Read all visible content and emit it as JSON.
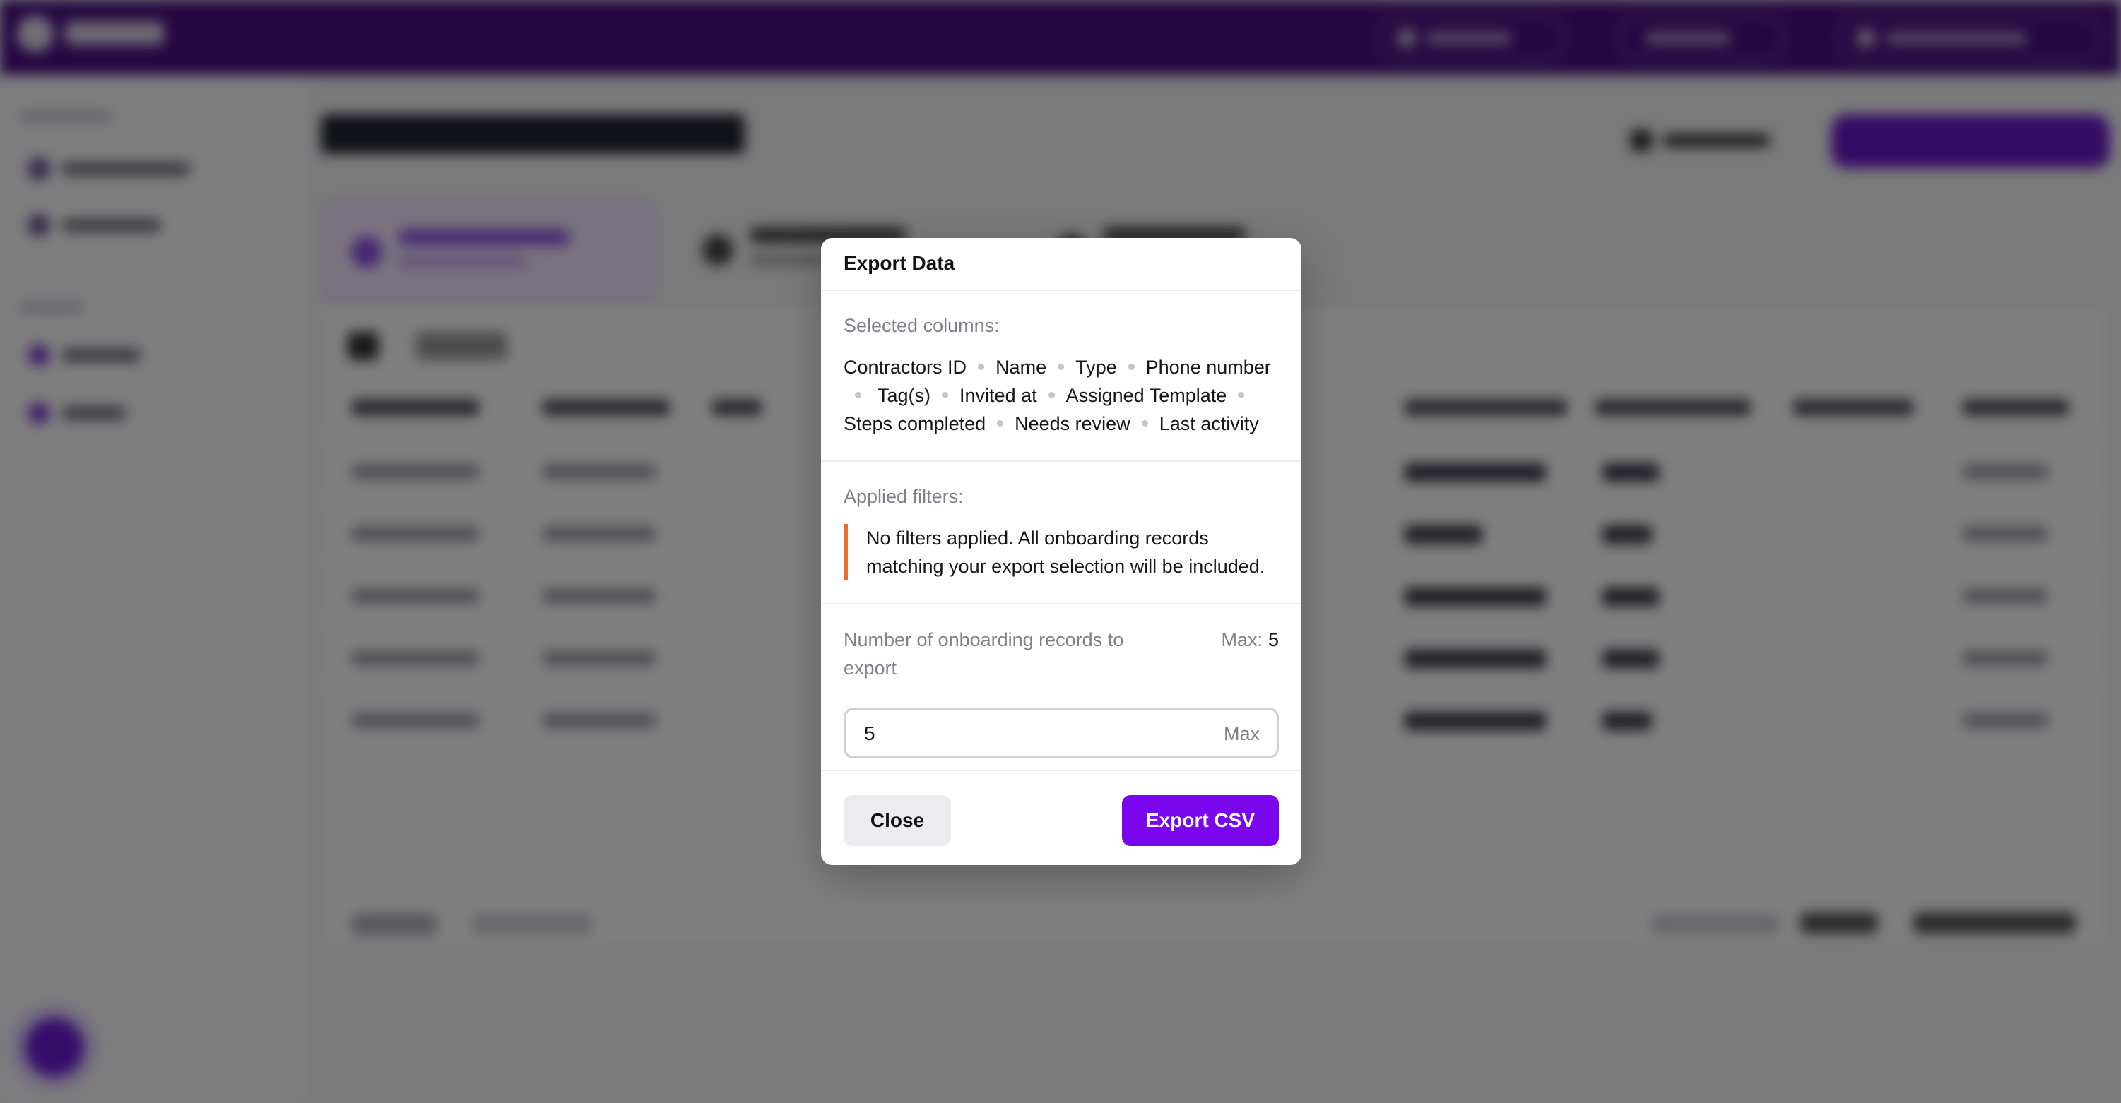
{
  "dialog": {
    "title": "Export Data",
    "selected_columns_label": "Selected columns:",
    "columns": [
      "Contractors ID",
      "Name",
      "Type",
      "Phone number",
      "Tag(s)",
      "Invited at",
      "Assigned Template",
      "Steps completed",
      "Needs review",
      "Last activity"
    ],
    "applied_filters_label": "Applied filters:",
    "filters_note": "No filters applied. All onboarding records matching your export selection will be included.",
    "record_count_label": "Number of onboarding records to export",
    "max_label": "Max:",
    "max_value": "5",
    "record_count_value": "5",
    "input_suffix": "Max",
    "close_label": "Close",
    "export_label": "Export CSV"
  },
  "colors": {
    "topbar": "#4a0f82",
    "accent": "#7a06ee",
    "filter_marker": "#f26a2a",
    "overlay": "rgba(0,0,0,0.5)"
  },
  "icons": {
    "logo": "app-logo-icon",
    "chat": "chat-bubble-icon"
  }
}
